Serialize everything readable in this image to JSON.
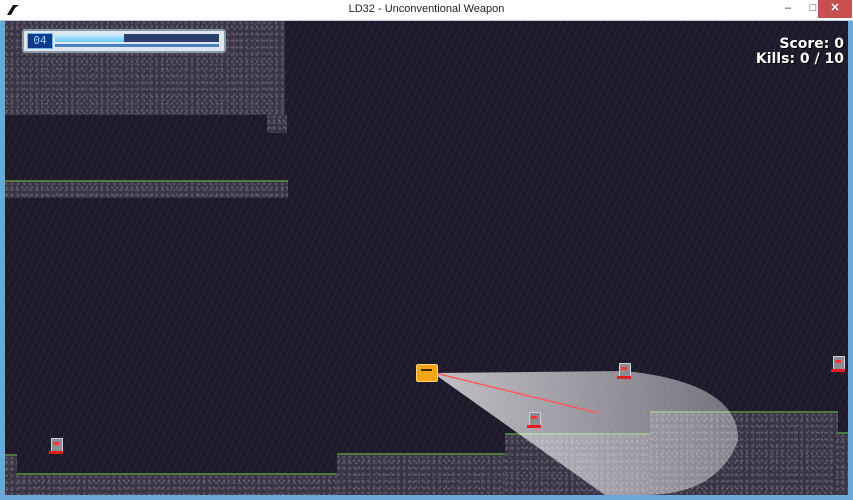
{
  "window": {
    "title": "LD32 - Unconventional Weapon",
    "controls": {
      "minimize": "–",
      "maximize": "□",
      "close": "✕"
    }
  },
  "hud": {
    "ammo_counter": "04",
    "health_fraction": 0.42,
    "score_label": "Score: 0",
    "kills_label": "Kills: 0 / 10"
  },
  "colors": {
    "background": "#1e1a29",
    "rock": "#3a3545",
    "grass": "#4f7a3e",
    "player": "#f2a516",
    "enemy_accent": "#e02020",
    "laser": "#ff5a5a"
  },
  "entities": {
    "player_name": "player-character",
    "enemy_count": 5
  }
}
